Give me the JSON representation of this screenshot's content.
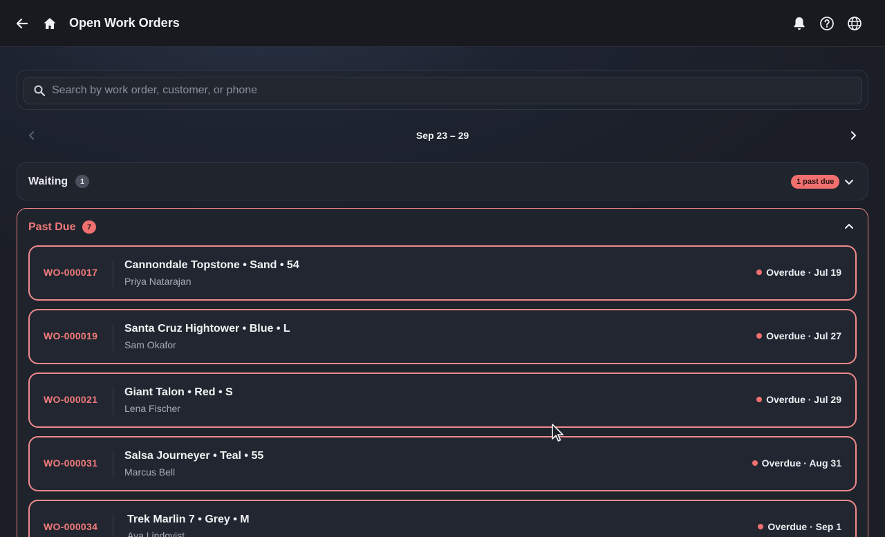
{
  "header": {
    "title": "Open Work Orders",
    "icons": [
      "back-arrow-icon",
      "home-icon",
      "bell-icon",
      "help-icon",
      "globe-icon"
    ]
  },
  "search": {
    "placeholder": "Search by work order, customer, or phone",
    "value": ""
  },
  "week": {
    "label": "Sep 23 – 29"
  },
  "groups": {
    "waiting": {
      "title": "Waiting",
      "count": "1",
      "past_due_badge": "1 past due"
    },
    "past_due": {
      "title": "Past Due",
      "count": "7",
      "orders": [
        {
          "id": "WO-000017",
          "title": "Cannondale Topstone • Sand • 54",
          "customer": "Priya Natarajan",
          "status": "Overdue · Jul 19"
        },
        {
          "id": "WO-000019",
          "title": "Santa Cruz Hightower • Blue • L",
          "customer": "Sam Okafor",
          "status": "Overdue · Jul 27"
        },
        {
          "id": "WO-000021",
          "title": "Giant Talon • Red • S",
          "customer": "Lena Fischer",
          "status": "Overdue · Jul 29"
        },
        {
          "id": "WO-000031",
          "title": "Salsa Journeyer • Teal • 55",
          "customer": "Marcus Bell",
          "status": "Overdue · Aug 31"
        },
        {
          "id": "WO-000034",
          "title": "Trek Marlin 7 • Grey • M",
          "customer": "Ava Lindqvist",
          "status": "Overdue · Sep 1"
        }
      ]
    }
  },
  "colors": {
    "accent_red": "#f07070",
    "background": "#1b1e26"
  }
}
